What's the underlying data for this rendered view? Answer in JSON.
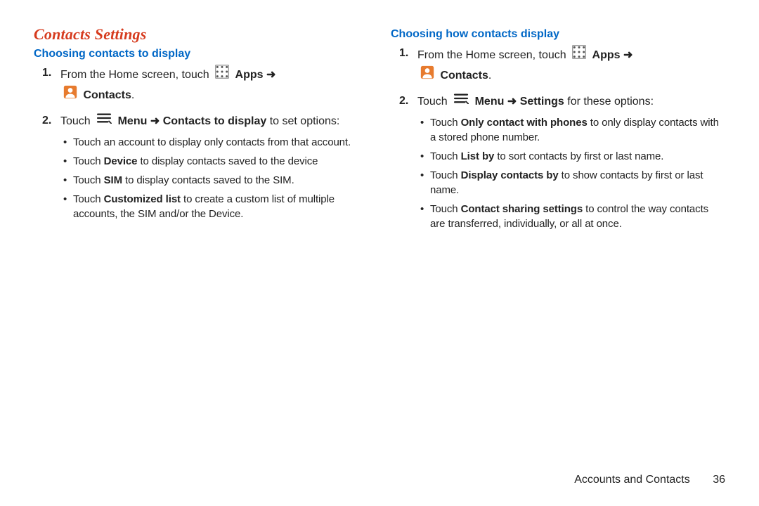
{
  "colors": {
    "accent_red": "#d63b1e",
    "accent_blue": "#0067c6"
  },
  "section_title": "Contacts Settings",
  "left": {
    "subhead": "Choosing contacts to display",
    "steps": {
      "s1": {
        "prefix": "From the Home screen, touch ",
        "apps_label": "Apps",
        "arrow1": " ➜ ",
        "contacts_label": "Contacts",
        "suffix": "."
      },
      "s2": {
        "prefix": "Touch ",
        "menu_label": "Menu",
        "arrow1": " ➜ ",
        "path_bold": "Contacts to display",
        "suffix": " to set options:",
        "bullets": {
          "b1": "Touch an account to display only contacts from that account.",
          "b2": {
            "pre": "Touch ",
            "bold": "Device",
            "post": " to display contacts saved to the device"
          },
          "b3": {
            "pre": "Touch ",
            "bold": "SIM",
            "post": " to display contacts saved to the SIM."
          },
          "b4": {
            "pre": "Touch ",
            "bold": "Customized list",
            "post": " to create a custom list of multiple accounts, the SIM and/or the Device."
          }
        }
      }
    }
  },
  "right": {
    "subhead": "Choosing how contacts display",
    "steps": {
      "s1": {
        "prefix": "From the Home screen, touch ",
        "apps_label": "Apps",
        "arrow1": " ➜ ",
        "contacts_label": "Contacts",
        "suffix": "."
      },
      "s2": {
        "prefix": "Touch ",
        "menu_label": "Menu",
        "arrow1": " ➜ ",
        "path_bold": "Settings",
        "suffix": " for these options:",
        "bullets": {
          "b1": {
            "pre": "Touch ",
            "bold": "Only contact with phones",
            "post": " to only display contacts with a stored phone number."
          },
          "b2": {
            "pre": "Touch ",
            "bold": "List by",
            "post": " to sort contacts by first or last name."
          },
          "b3": {
            "pre": "Touch ",
            "bold": "Display contacts by",
            "post": " to show contacts by first or last name."
          },
          "b4": {
            "pre": "Touch ",
            "bold": "Contact sharing settings",
            "post": " to control the way contacts are transferred, individually, or all at once."
          }
        }
      }
    }
  },
  "footer": {
    "chapter": "Accounts and Contacts",
    "page": "36"
  },
  "icons": {
    "apps": "apps-grid-icon",
    "contacts": "contacts-icon",
    "menu": "menu-icon"
  }
}
